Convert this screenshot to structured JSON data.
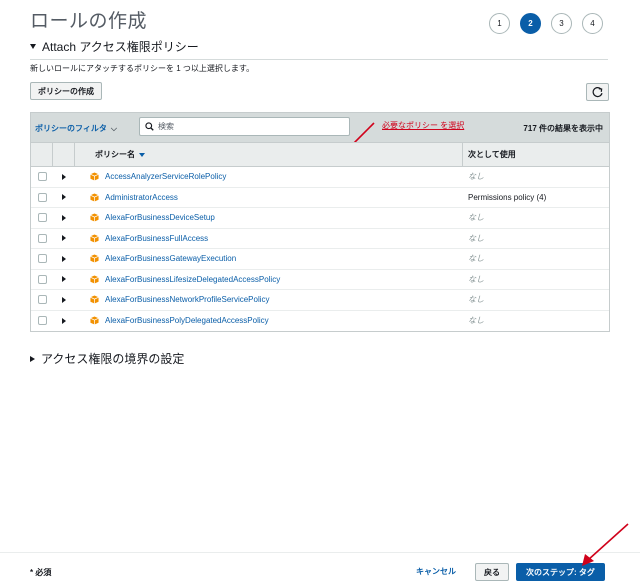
{
  "page": {
    "title": "ロールの作成"
  },
  "steps": [
    "1",
    "2",
    "3",
    "4"
  ],
  "active_step": "2",
  "section": {
    "title": "Attach アクセス権限ポリシー",
    "description": "新しいロールにアタッチするポリシーを 1 つ以上選択します。"
  },
  "toolbar": {
    "create_policy_label": "ポリシーの作成",
    "refresh_icon": "refresh-icon"
  },
  "filter": {
    "label": "ポリシーのフィルタ",
    "search_placeholder": "検索",
    "annotation": "必要なポリシー を選択",
    "result_count": "717 件の結果を表示中"
  },
  "table": {
    "headers": {
      "name": "ポリシー名",
      "used_as": "次として使用"
    },
    "rows": [
      {
        "name": "AccessAnalyzerServiceRolePolicy",
        "used_as": "なし"
      },
      {
        "name": "AdministratorAccess",
        "used_as": "Permissions policy (4)"
      },
      {
        "name": "AlexaForBusinessDeviceSetup",
        "used_as": "なし"
      },
      {
        "name": "AlexaForBusinessFullAccess",
        "used_as": "なし"
      },
      {
        "name": "AlexaForBusinessGatewayExecution",
        "used_as": "なし"
      },
      {
        "name": "AlexaForBusinessLifesizeDelegatedAccessPolicy",
        "used_as": "なし"
      },
      {
        "name": "AlexaForBusinessNetworkProfileServicePolicy",
        "used_as": "なし"
      },
      {
        "name": "AlexaForBusinessPolyDelegatedAccessPolicy",
        "used_as": "なし"
      }
    ]
  },
  "boundary": {
    "title": "アクセス権限の境界の設定"
  },
  "footer": {
    "required": "* 必須",
    "cancel": "キャンセル",
    "back": "戻る",
    "next": "次のステップ: タグ"
  },
  "colors": {
    "accent": "#0a5ea8",
    "annotation": "#d0021b",
    "policy_icon": "#f29100"
  }
}
